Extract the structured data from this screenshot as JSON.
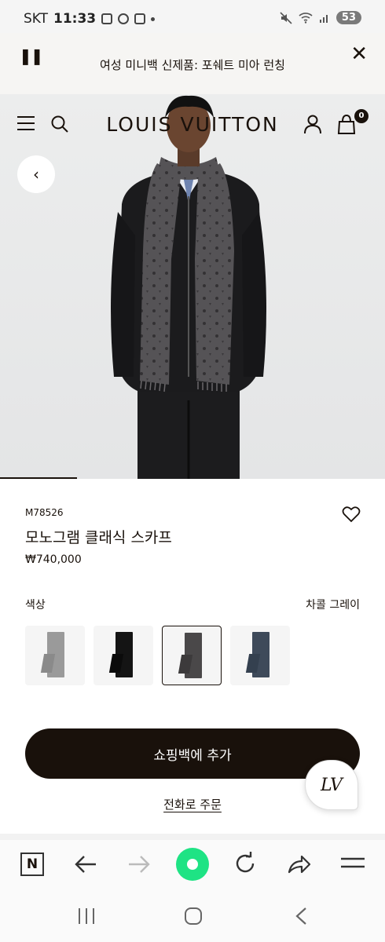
{
  "status_bar": {
    "carrier": "SKT",
    "time": "11:33",
    "battery": "53"
  },
  "promo": {
    "text": "여성 미니백 신제품: 포쉐트 미아 런칭"
  },
  "header": {
    "logo": "LOUIS VUITTON",
    "bag_count": "0"
  },
  "product": {
    "sku": "M78526",
    "name": "모노그램 클래식 스카프",
    "price": "₩740,000",
    "color_label": "색상",
    "selected_color": "차콜 그레이",
    "swatch_colors": [
      "#9a9a9a",
      "#141414",
      "#4a4849",
      "#3e4a5a"
    ]
  },
  "actions": {
    "add_to_bag": "쇼핑백에 추가",
    "phone_order": "전화로 주문",
    "chat_logo": "LV"
  }
}
